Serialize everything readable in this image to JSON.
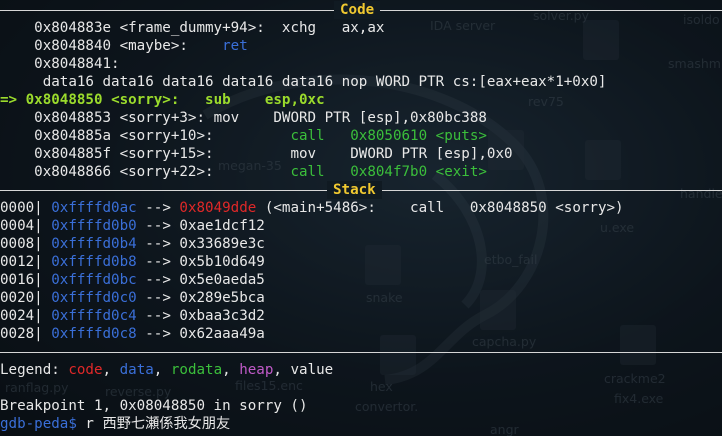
{
  "background": {
    "items": [
      {
        "label": "IDA server"
      },
      {
        "label": "solver.py"
      },
      {
        "label": "isoldo"
      },
      {
        "label": "smashm"
      },
      {
        "label": "rev75"
      },
      {
        "label": "megan-35"
      },
      {
        "label": "handle"
      },
      {
        "label": "u.exe"
      },
      {
        "label": "etbo_fail"
      },
      {
        "label": "snake"
      },
      {
        "label": "capcha.py"
      },
      {
        "label": "crackme2"
      },
      {
        "label": "fix4.exe"
      },
      {
        "label": "hex"
      },
      {
        "label": "convertor."
      },
      {
        "label": "files15.enc"
      },
      {
        "label": "reverse.py"
      },
      {
        "label": "ranflag.py"
      },
      {
        "label": "angr"
      }
    ]
  },
  "code": {
    "title": "Code",
    "lines": [
      {
        "addr": "0x804883e",
        "sym": "<frame_dummy+94>:",
        "op": "xchg",
        "args": "ax,ax"
      },
      {
        "addr": "0x8048840",
        "sym": "<maybe>:",
        "op": "ret",
        "args": ""
      },
      {
        "addr": "0x8048841:",
        "sym": "",
        "op": "",
        "args": ""
      },
      {
        "text": "data16 data16 data16 data16 data16 nop WORD PTR cs:[eax+eax*1+0x0]"
      },
      {
        "marker": "=>",
        "addr": "0x8048850",
        "sym": "<sorry>:",
        "op": "sub",
        "args": "esp,0xc"
      },
      {
        "addr": "0x8048853",
        "sym": "<sorry+3>:",
        "op": "mov",
        "args": "DWORD PTR [esp],0x80bc388"
      },
      {
        "addr": "0x804885a",
        "sym": "<sorry+10>:",
        "op": "call",
        "args": "0x8050610 <puts>"
      },
      {
        "addr": "0x804885f",
        "sym": "<sorry+15>:",
        "op": "mov",
        "args": "DWORD PTR [esp],0x0"
      },
      {
        "addr": "0x8048866",
        "sym": "<sorry+22>:",
        "op": "call",
        "args": "0x804f7b0 <exit>"
      }
    ]
  },
  "stack": {
    "title": "Stack",
    "rows": [
      {
        "off": "0000|",
        "addr": "0xffffd0ac",
        "arrow": "-->",
        "val": "0x8049dde",
        "extra": "(<main+5486>:    call   0x8048850 <sorry>)"
      },
      {
        "off": "0004|",
        "addr": "0xffffd0b0",
        "arrow": "-->",
        "val": "0xae1dcf12",
        "extra": ""
      },
      {
        "off": "0008|",
        "addr": "0xffffd0b4",
        "arrow": "-->",
        "val": "0x33689e3c",
        "extra": ""
      },
      {
        "off": "0012|",
        "addr": "0xffffd0b8",
        "arrow": "-->",
        "val": "0x5b10d649",
        "extra": ""
      },
      {
        "off": "0016|",
        "addr": "0xffffd0bc",
        "arrow": "-->",
        "val": "0x5e0aeda5",
        "extra": ""
      },
      {
        "off": "0020|",
        "addr": "0xffffd0c0",
        "arrow": "-->",
        "val": "0x289e5bca",
        "extra": ""
      },
      {
        "off": "0024|",
        "addr": "0xffffd0c4",
        "arrow": "-->",
        "val": "0xbaa3c3d2",
        "extra": ""
      },
      {
        "off": "0028|",
        "addr": "0xffffd0c8",
        "arrow": "-->",
        "val": "0x62aaa49a",
        "extra": ""
      }
    ]
  },
  "legend": {
    "label": "Legend: ",
    "code": "code",
    "data": "data",
    "rodata": "rodata",
    "heap": "heap",
    "value": "value",
    "sep": ", "
  },
  "breakpoint": "Breakpoint 1, 0x08048850 in sorry ()",
  "prompt": {
    "label": "gdb-peda$",
    "input": "r 西野七瀬係我女朋友"
  },
  "colors": {
    "code_header": "#f0c830",
    "current_line": "#9bdb2c",
    "call_green": "#3bbf3b",
    "address_blue": "#3a6fd8",
    "code_red": "#e02828",
    "heap_purple": "#c05ac8"
  }
}
